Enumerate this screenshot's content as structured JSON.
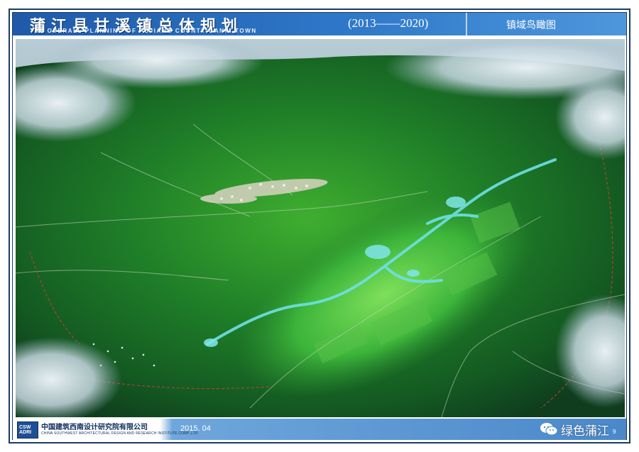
{
  "header": {
    "title_cn": "蒲江县甘溪镇总体规划",
    "title_en": "THE OVERALL PLANNING OF PUJIANG COUNTY GANXI TOWN",
    "years": "(2013——2020)",
    "sheet_name": "镇域鸟瞰图"
  },
  "footer": {
    "logo_text": "CSW ADRI",
    "org_cn": "中国建筑西南设计研究院有限公司",
    "org_en": "CHINA SOUTHWEST ARCHITECTURAL DESIGN AND RESEARCH INSTITUTE CORP.,LTD",
    "date": "2015. 04",
    "wechat_name": "绿色蒲江",
    "page_num": "9"
  },
  "colors": {
    "header_blue": "#1f5aa8",
    "frame_navy": "#1b3a6b",
    "forest_green": "#1e6b2a",
    "water_cyan": "#6fe0e6",
    "boundary_red": "#d0403a"
  }
}
